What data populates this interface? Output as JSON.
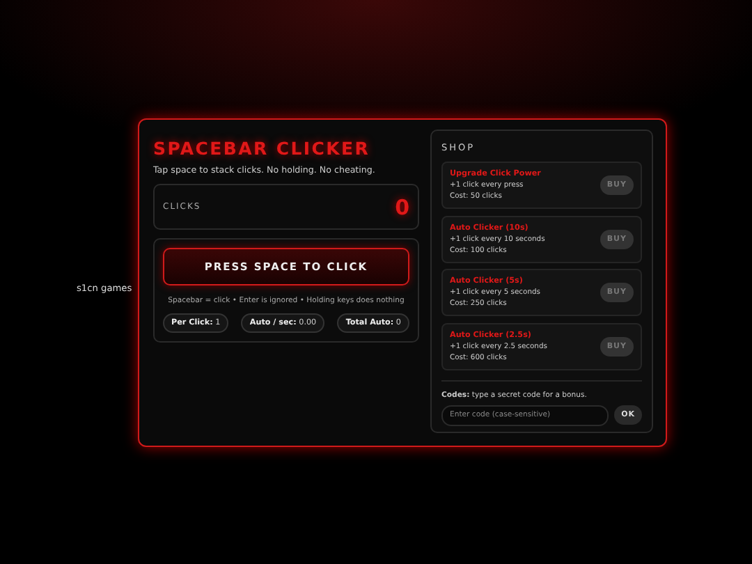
{
  "side_label": "s1cn games",
  "game": {
    "title": "SPACEBAR CLICKER",
    "subtitle": "Tap space to stack clicks. No holding. No cheating.",
    "counter": {
      "label": "CLICKS",
      "value": "0"
    },
    "press_button": "PRESS SPACE TO CLICK",
    "hint": "Spacebar = click • Enter is ignored • Holding keys does nothing",
    "stats": [
      {
        "label": "Per Click:",
        "value": "1"
      },
      {
        "label": "Auto / sec:",
        "value": "0.00"
      },
      {
        "label": "Total Auto:",
        "value": "0"
      }
    ]
  },
  "shop": {
    "title": "SHOP",
    "items": [
      {
        "name": "Upgrade Click Power",
        "description": "+1 click every press",
        "cost": "Cost: 50 clicks",
        "button": "BUY",
        "disabled": true
      },
      {
        "name": "Auto Clicker (10s)",
        "description": "+1 click every 10 seconds",
        "cost": "Cost: 100 clicks",
        "button": "BUY",
        "disabled": true
      },
      {
        "name": "Auto Clicker (5s)",
        "description": "+1 click every 5 seconds",
        "cost": "Cost: 250 clicks",
        "button": "BUY",
        "disabled": true
      },
      {
        "name": "Auto Clicker (2.5s)",
        "description": "+1 click every 2.5 seconds",
        "cost": "Cost: 600 clicks",
        "button": "BUY",
        "disabled": true
      }
    ],
    "codes": {
      "label": "**Codes:** type a secret code for a bonus.",
      "placeholder": "Enter code (case-sensitive)",
      "button": "OK"
    }
  }
}
